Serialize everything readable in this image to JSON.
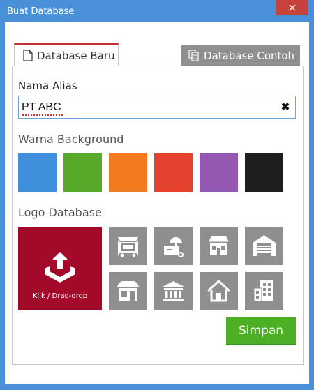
{
  "window": {
    "title": "Buat Database"
  },
  "tabs": [
    {
      "label": "Database Baru",
      "icon": "document-icon",
      "active": true
    },
    {
      "label": "Database Contoh",
      "icon": "copy-documents-icon",
      "active": false
    }
  ],
  "form": {
    "alias_label": "Nama Alias",
    "alias_value": "PT ABC",
    "clear_icon": "close-x-icon",
    "background_label": "Warna Background",
    "colors": [
      "#3f8fdc",
      "#58a82a",
      "#f47a20",
      "#e3432e",
      "#9457b2",
      "#1e1e1e"
    ],
    "logo_label": "Logo Database",
    "upload_label": "Klik / Drag-drop",
    "upload_icon": "upload-tray-icon",
    "logo_icons": [
      "food-cart-icon",
      "ice-cream-cart-icon",
      "store-front-icon",
      "garage-icon",
      "shop-icon",
      "bank-icon",
      "house-icon",
      "office-building-icon"
    ],
    "save_label": "Simpan"
  },
  "style": {
    "titlebar_color": "#4a90d9",
    "close_color": "#c8423c",
    "tab_accent": "#c03030",
    "upload_color": "#a30a2a",
    "tile_color": "#8f8f8f",
    "save_color": "#4caf24"
  }
}
